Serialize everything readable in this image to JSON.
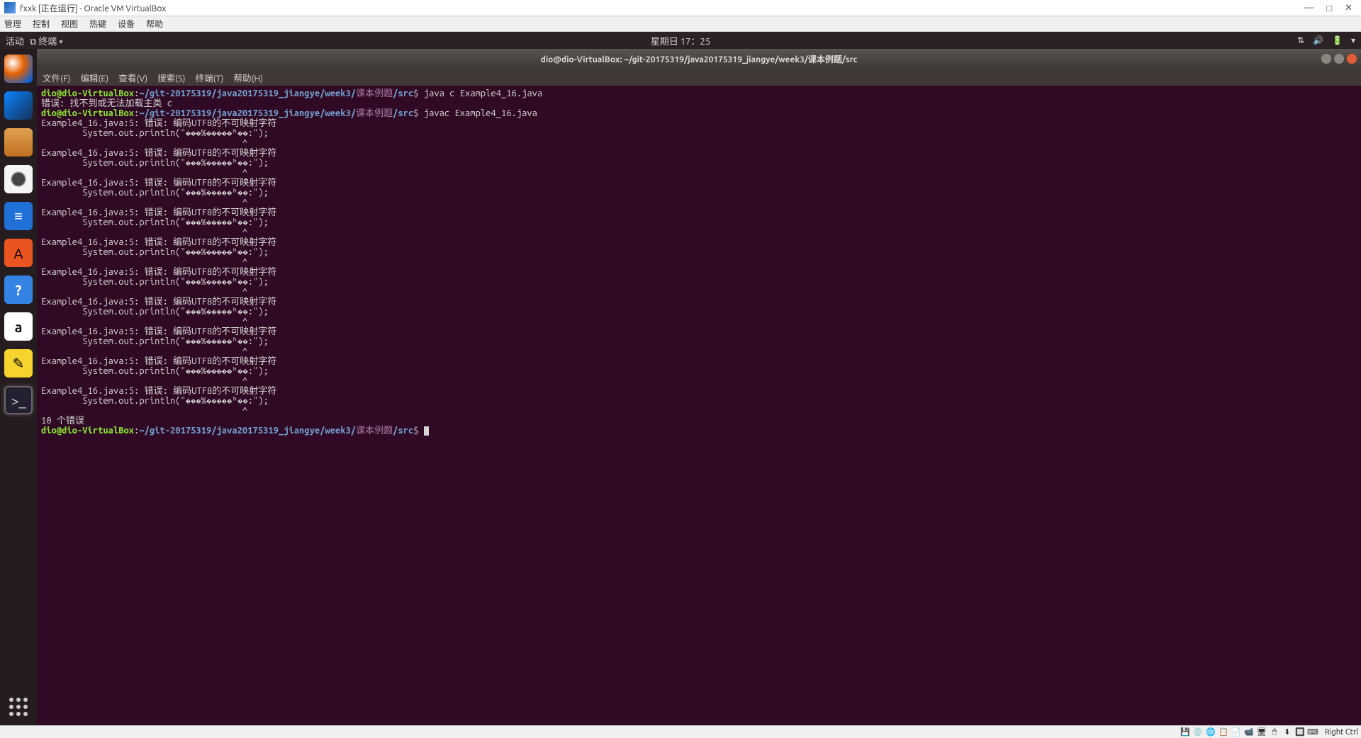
{
  "vbox": {
    "title": "fxxk [正在运行] - Oracle VM VirtualBox",
    "controls": {
      "min": "—",
      "max": "□",
      "close": "✕"
    },
    "menu": [
      "管理",
      "控制",
      "视图",
      "热键",
      "设备",
      "帮助"
    ],
    "status": {
      "icons": [
        "💾",
        "💿",
        "🌐",
        "📋",
        "📄",
        "📹",
        "🖥",
        "🖱",
        "⬇",
        "🔲",
        "⌨"
      ],
      "rightctrl": "Right Ctrl"
    }
  },
  "ubuntu": {
    "activities": "活动",
    "app_indicator": "⧉ 终端 ▾",
    "clock": "星期日 17：25",
    "tray": [
      "⇅",
      "🔊",
      "🔋",
      "▾"
    ]
  },
  "dock": {
    "firefox": "",
    "thunderbird": "",
    "files": "",
    "rhythmbox": "",
    "doc": "≡",
    "store": "A",
    "help": "?",
    "amazon": "a",
    "gedit": "✎",
    "terminal": ">_"
  },
  "term": {
    "title": "dio@dio-VirtualBox: ~/git-20175319/java20175319_jiangye/week3/课本例题/src",
    "menu": [
      "文件(F)",
      "编辑(E)",
      "查看(V)",
      "搜索(S)",
      "终端(T)",
      "帮助(H)"
    ],
    "prompt_user": "dio@dio-VirtualBox",
    "prompt_path_a": "~/git-20175319/java20175319_jiangye/week3/",
    "prompt_path_cn": "课本例题",
    "prompt_path_b": "/src",
    "cmd1": " java c Example4_16.java",
    "err1": "错误: 找不到或无法加载主类 c",
    "cmd2": " javac Example4_16.java",
    "blk_l1": "Example4_16.java:5: 错误: 编码UTF8的不可映射字符",
    "blk_l2": "        System.out.println(\"���%�����ʰ��:\");",
    "blk_l3": "                                       ^",
    "summary": "10 个错误",
    "error_count": 10
  }
}
